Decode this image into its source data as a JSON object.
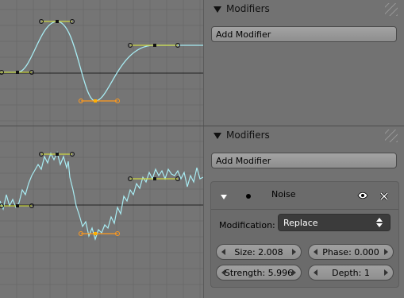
{
  "top_panel": {
    "title": "Modifiers",
    "add_button": "Add Modifier"
  },
  "bottom_panel": {
    "title": "Modifiers",
    "add_button": "Add Modifier",
    "modifier": {
      "name": "Noise",
      "modification_label": "Modification:",
      "modification_value": "Replace",
      "size": "Size: 2.008",
      "phase": "Phase: 0.000",
      "strength": "Strength: 5.996",
      "depth": "Depth: 1"
    }
  },
  "icons": {
    "collapse": "triangle-down-icon",
    "grip": "grip-icon",
    "expand": "disclosure-icon",
    "mute": "dot-icon",
    "visibility": "eye-icon",
    "remove": "close-icon",
    "select": "updown-arrows-icon",
    "decrement": "arrow-left-icon",
    "increment": "arrow-right-icon"
  },
  "colors": {
    "curve": "#a8ecf3",
    "handle": "#cdd843",
    "handle_selected": "#ff9a1f",
    "zero_line": "#222222",
    "grid": "#6a6a6a"
  }
}
